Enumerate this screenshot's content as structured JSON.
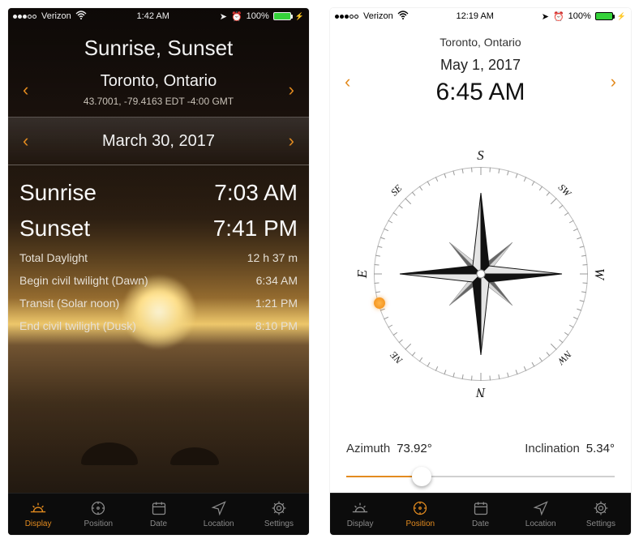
{
  "status": {
    "carrier": "Verizon",
    "time_left": "1:42 AM",
    "time_right": "12:19 AM",
    "battery": "100%"
  },
  "left": {
    "title": "Sunrise, Sunset",
    "city": "Toronto, Ontario",
    "coords": "43.7001, -79.4163    EDT -4:00 GMT",
    "date": "March 30, 2017",
    "sunrise_label": "Sunrise",
    "sunrise_time": "7:03 AM",
    "sunset_label": "Sunset",
    "sunset_time": "7:41 PM",
    "details": [
      {
        "label": "Total Daylight",
        "value": "12 h 37 m"
      },
      {
        "label": "Begin civil twilight (Dawn)",
        "value": "6:34 AM"
      },
      {
        "label": "Transit (Solar noon)",
        "value": "1:21 PM"
      },
      {
        "label": "End civil twilight (Dusk)",
        "value": "8:10 PM"
      }
    ]
  },
  "right": {
    "city": "Toronto, Ontario",
    "date": "May 1, 2017",
    "time": "6:45 AM",
    "azimuth_label": "Azimuth",
    "azimuth_value": "73.92°",
    "inclination_label": "Inclination",
    "inclination_value": "5.34°",
    "slider_percent": 28,
    "compass_dirs": {
      "N": "N",
      "NE": "NE",
      "E": "E",
      "SE": "SE",
      "S": "S",
      "SW": "SW",
      "W": "W",
      "NW": "NW"
    },
    "sun_azimuth": 73.92
  },
  "tabs": [
    {
      "id": "display",
      "label": "Display"
    },
    {
      "id": "position",
      "label": "Position"
    },
    {
      "id": "date",
      "label": "Date"
    },
    {
      "id": "location",
      "label": "Location"
    },
    {
      "id": "settings",
      "label": "Settings"
    }
  ],
  "colors": {
    "accent": "#e38b1f"
  }
}
